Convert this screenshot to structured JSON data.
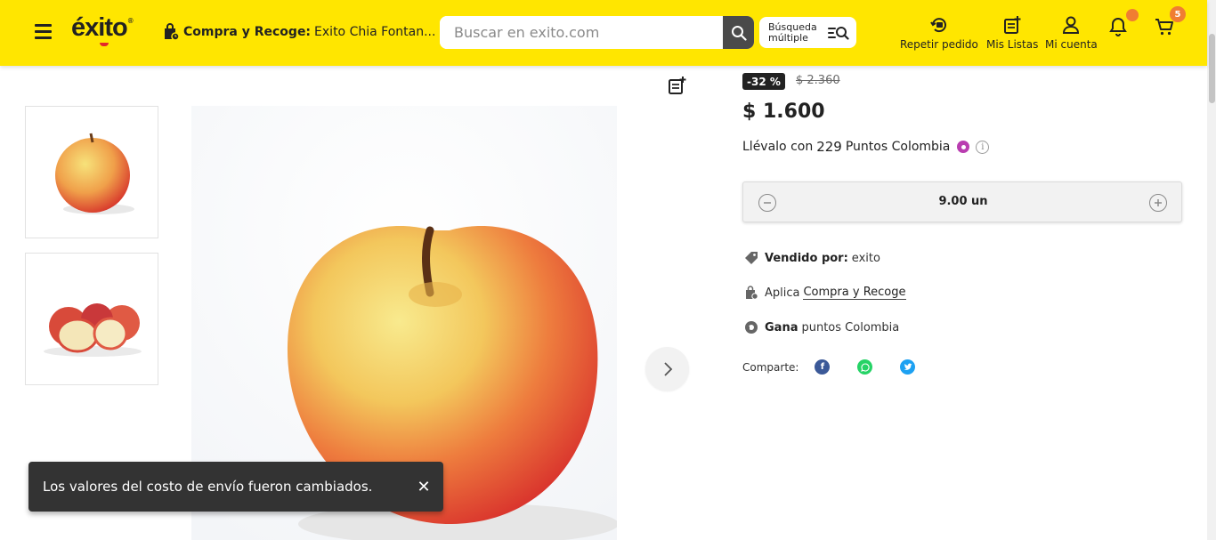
{
  "header": {
    "logo_text": "éxito",
    "store_label": "Compra y Recoge:",
    "store_name": "Exito Chia Fontan...",
    "search_placeholder": "Buscar en exito.com",
    "multi_search_label": "Búsqueda múltiple",
    "nav": {
      "repeat_order": "Repetir pedido",
      "my_lists": "Mis Listas",
      "my_account": "Mi cuenta"
    },
    "cart_count": "5"
  },
  "product": {
    "discount": "-32 %",
    "old_price": "$ 2.360",
    "price": "$ 1.600",
    "points_prefix": "Llévalo con",
    "points_value": "229",
    "points_suffix": "Puntos Colombia",
    "quantity": "9.00 un",
    "sold_by_label": "Vendido por:",
    "sold_by_value": "exito",
    "pickup_prefix": "Aplica",
    "pickup_link": "Compra y Recoge",
    "earn_label": "Gana",
    "earn_value": "puntos Colombia",
    "share_label": "Comparte:"
  },
  "toast": {
    "message": "Los valores del costo de envío fueron cambiados.",
    "close": "✕"
  },
  "colors": {
    "header_bg": "#ffe600",
    "accent_orange": "#f07d32",
    "toast_bg": "#333333",
    "facebook": "#3b5998",
    "whatsapp": "#25d366",
    "twitter": "#1da1f2"
  }
}
